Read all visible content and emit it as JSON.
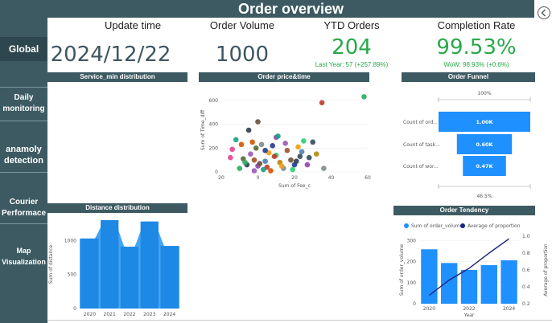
{
  "header": {
    "title": "Order overview"
  },
  "sidebar": {
    "items": [
      {
        "label": "Global",
        "active": true
      },
      {
        "label": "Daily monitoring"
      },
      {
        "label": "anamoly detection"
      },
      {
        "label": "Courier Performace"
      },
      {
        "label": "Map Visualization"
      }
    ]
  },
  "kpis": {
    "update_time": {
      "label": "Update time",
      "value": "2024/12/22"
    },
    "order_volume": {
      "label": "Order Volume",
      "value": "1000"
    },
    "ytd_orders": {
      "label": "YTD Orders",
      "value": "204",
      "sub": "Last Year: 57 (+257.89%)"
    },
    "completion_rate": {
      "label": "Completion Rate",
      "value": "99.53%",
      "sub": "WoW: 98.93% (+0.6%)"
    }
  },
  "panels": {
    "service_min": {
      "title": "Service_min distribution"
    },
    "price_time": {
      "title": "Order price&time"
    },
    "funnel": {
      "title": "Order Funnel"
    },
    "distance": {
      "title": "Distance distribution"
    },
    "tendency": {
      "title": "Order Tendency"
    }
  },
  "colors": {
    "accent": "#3d5a62",
    "positive": "#29a84a",
    "bar": "#1e90ff",
    "line": "#1a237e"
  },
  "chart_data": [
    {
      "type": "scatter",
      "title": "Order price&time",
      "xlabel": "Sum of Fee_c",
      "ylabel": "Sum of Time_diff",
      "xlim": [
        -20,
        60
      ],
      "ylim": [
        0,
        700
      ],
      "xticks": [
        "20",
        "0",
        "20",
        "40",
        "60"
      ],
      "yticks": [
        "0",
        "200",
        "400",
        "600"
      ],
      "points": [
        [
          0,
          420
        ],
        [
          35,
          580
        ],
        [
          58,
          630
        ],
        [
          -5,
          350
        ],
        [
          10,
          290
        ],
        [
          -12,
          270
        ],
        [
          -3,
          250
        ],
        [
          2,
          230
        ],
        [
          8,
          220
        ],
        [
          15,
          240
        ],
        [
          22,
          210
        ],
        [
          25,
          260
        ],
        [
          30,
          250
        ],
        [
          -15,
          120
        ],
        [
          -8,
          110
        ],
        [
          -2,
          100
        ],
        [
          4,
          90
        ],
        [
          12,
          80
        ],
        [
          18,
          100
        ],
        [
          5,
          40
        ],
        [
          -10,
          30
        ],
        [
          -6,
          60
        ],
        [
          0,
          50
        ],
        [
          3,
          20
        ],
        [
          7,
          10
        ],
        [
          14,
          30
        ],
        [
          20,
          60
        ],
        [
          -4,
          150
        ],
        [
          6,
          160
        ],
        [
          10,
          140
        ],
        [
          28,
          120
        ],
        [
          -14,
          190
        ],
        [
          -1,
          200
        ],
        [
          16,
          180
        ],
        [
          24,
          170
        ],
        [
          32,
          150
        ],
        [
          1,
          70
        ],
        [
          9,
          130
        ],
        [
          -7,
          80
        ],
        [
          21,
          90
        ],
        [
          27,
          60
        ],
        [
          11,
          300
        ],
        [
          -9,
          230
        ],
        [
          36,
          30
        ],
        [
          4,
          180
        ],
        [
          -2,
          10
        ],
        [
          13,
          50
        ],
        [
          19,
          20
        ],
        [
          23,
          130
        ]
      ]
    },
    {
      "type": "bar",
      "title": "Order Funnel",
      "top_label": "100%",
      "bottom_label": "46.5%",
      "categories": [
        "Count of ord...",
        "Count of task...",
        "Count of wor..."
      ],
      "values": [
        1000,
        600,
        470
      ],
      "data_labels": [
        "1.00K",
        "0.60K",
        "0.47K"
      ]
    },
    {
      "type": "area",
      "title": "Distance distribution",
      "ylabel": "Sum of distance",
      "categories": [
        "2020",
        "2021",
        "2022",
        "2023",
        "2024"
      ],
      "yticks": [
        "0",
        "500",
        "1000"
      ],
      "ylim": [
        0,
        1300
      ],
      "values": [
        1030,
        1300,
        910,
        1280,
        920
      ]
    },
    {
      "type": "bar",
      "title": "Order Tendency",
      "xlabel": "Year",
      "ylabel": "Sum of order_volume",
      "y2label": "Average of proportion",
      "categories": [
        "2020",
        "2021",
        "2022",
        "2023",
        "2024"
      ],
      "xticks": [
        "2020",
        "2022",
        "2024"
      ],
      "yticks": [
        "0",
        "100",
        "200",
        "300"
      ],
      "y2ticks": [
        "0.2",
        "0.4",
        "0.6",
        "0.8",
        "1.0"
      ],
      "ylim": [
        0,
        320
      ],
      "y2lim": [
        0.2,
        1.0
      ],
      "series": [
        {
          "name": "Sum of order_volume",
          "values": [
            258,
            193,
            160,
            183,
            206
          ]
        },
        {
          "name": "Average of proportion",
          "values": [
            0.3,
            0.48,
            0.62,
            0.8,
            0.97
          ]
        }
      ]
    }
  ]
}
